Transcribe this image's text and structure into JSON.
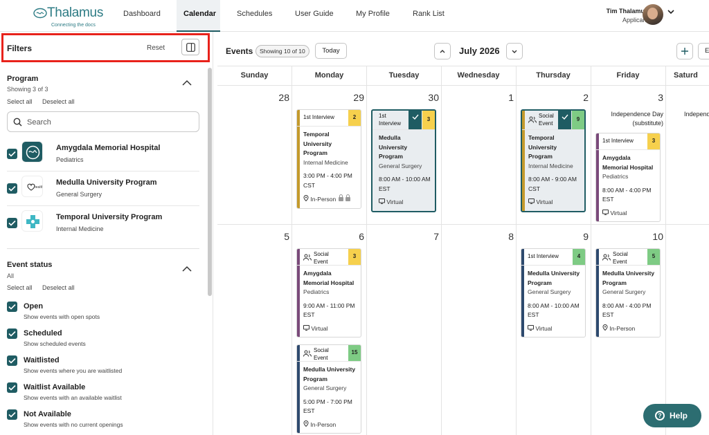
{
  "app": {
    "name": "Thalamus",
    "tagline": "Connecting the docs"
  },
  "nav": {
    "items": [
      "Dashboard",
      "Calendar",
      "Schedules",
      "User Guide",
      "My Profile",
      "Rank List"
    ],
    "active": "Calendar"
  },
  "user": {
    "name": "Tim Thalamus",
    "role": "Applicant"
  },
  "filters": {
    "title": "Filters",
    "reset": "Reset",
    "program": {
      "title": "Program",
      "showing": "Showing 3 of 3",
      "select_all": "Select all",
      "deselect_all": "Deselect all",
      "search_placeholder": "Search",
      "items": [
        {
          "name": "Amygdala Memorial Hospital",
          "specialty": "Pediatrics"
        },
        {
          "name": "Medulla University Program",
          "specialty": "General Surgery"
        },
        {
          "name": "Temporal University Program",
          "specialty": "Internal Medicine"
        }
      ]
    },
    "event_status": {
      "title": "Event status",
      "sub": "All",
      "select_all": "Select all",
      "deselect_all": "Deselect all",
      "items": [
        {
          "label": "Open",
          "desc": "Show events with open spots"
        },
        {
          "label": "Scheduled",
          "desc": "Show scheduled events"
        },
        {
          "label": "Waitlisted",
          "desc": "Show events where you are waitlisted"
        },
        {
          "label": "Waitlist Available",
          "desc": "Show events with an available waitlist"
        },
        {
          "label": "Not Available",
          "desc": "Show events with no current openings"
        }
      ]
    }
  },
  "calendar": {
    "title": "Events",
    "showing": "Showing 10 of 10",
    "today": "Today",
    "month": "July 2026",
    "export_label": "E",
    "days": [
      "Sunday",
      "Monday",
      "Tuesday",
      "Wednesday",
      "Thursday",
      "Friday",
      "Saturd"
    ],
    "week1": [
      "28",
      "29",
      "30",
      "1",
      "2",
      "3"
    ],
    "week2": [
      "5",
      "6",
      "7",
      "8",
      "9",
      "10"
    ],
    "holiday": {
      "line1": "Independence Day",
      "line2": "(substitute)",
      "sat": "Independe"
    },
    "events": {
      "e1": {
        "type": "1st Interview",
        "num": "2",
        "program": "Temporal University Program",
        "spec": "Internal Medicine",
        "time": "3:00 PM - 4:00 PM CST",
        "mode": "In-Person"
      },
      "e2": {
        "type": "1st Interview",
        "num": "3",
        "program": "Medulla University Program",
        "spec": "General Surgery",
        "time": "8:00 AM - 10:00 AM EST",
        "mode": "Virtual"
      },
      "e3": {
        "type": "Social Event",
        "num": "9",
        "program": "Temporal University Program",
        "spec": "Internal Medicine",
        "time": "8:00 AM - 9:00 AM CST",
        "mode": "Virtual"
      },
      "e4": {
        "type": "1st Interview",
        "num": "3",
        "program": "Amygdala Memorial Hospital",
        "spec": "Pediatrics",
        "time": "8:00 AM - 4:00 PM EST",
        "mode": "Virtual"
      },
      "e5": {
        "type": "Social Event",
        "num": "3",
        "program": "Amygdala Memorial Hospital",
        "spec": "Pediatrics",
        "time": "9:00 AM - 11:00 PM EST",
        "mode": "Virtual"
      },
      "e6": {
        "type": "Social Event",
        "num": "15",
        "program": "Medulla University Program",
        "spec": "General Surgery",
        "time": "5:00 PM - 7:00 PM EST",
        "mode": "In-Person"
      },
      "e7": {
        "type": "1st Interview",
        "num": "4",
        "program": "Medulla University Program",
        "spec": "General Surgery",
        "time": "8:00 AM - 10:00 AM EST",
        "mode": "Virtual"
      },
      "e8": {
        "type": "Social Event",
        "num": "5",
        "program": "Medulla University Program",
        "spec": "General Surgery",
        "time": "8:00 AM - 4:00 PM EST",
        "mode": "In-Person"
      }
    }
  },
  "help": "Help",
  "colors": {
    "brand": "#1f5c63",
    "temporal": "#c49a2c",
    "medulla": "#2e4a6e",
    "amygdala": "#7a4a7a",
    "yellow": "#f6d04d",
    "green": "#7ecb84"
  }
}
